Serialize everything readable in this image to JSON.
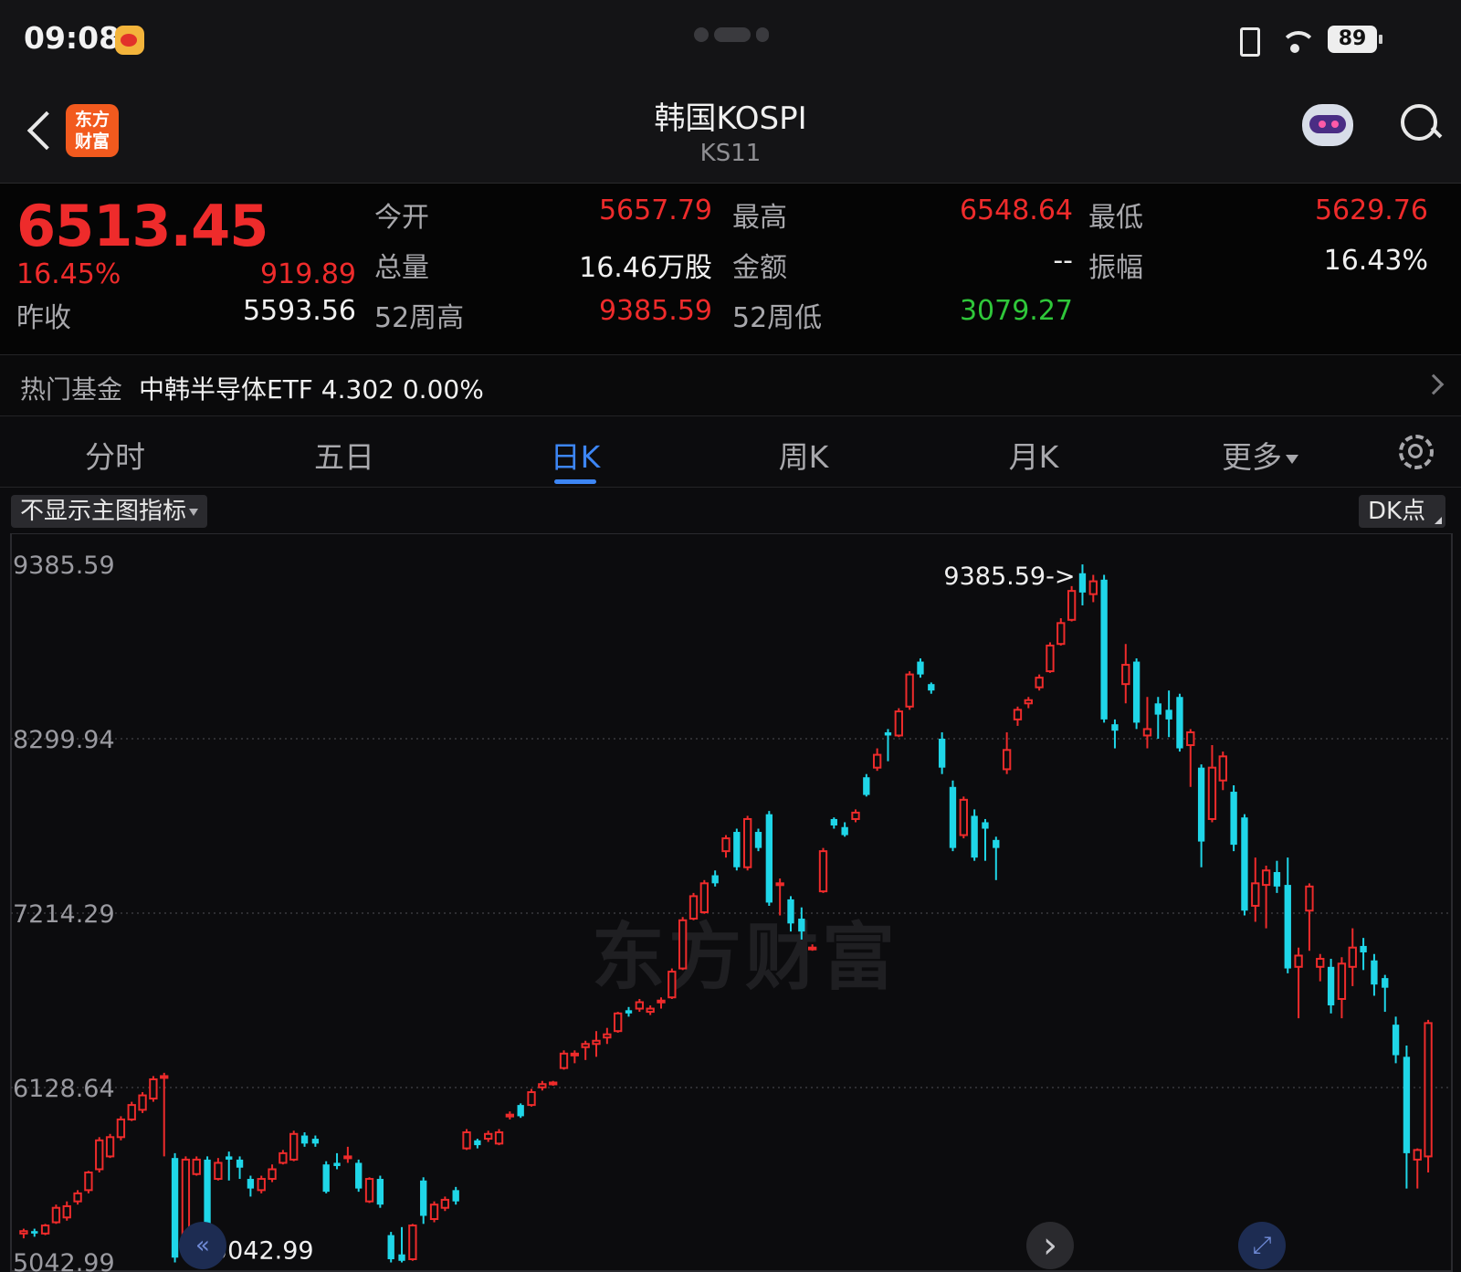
{
  "status_bar": {
    "time": "09:08",
    "battery": "89"
  },
  "header": {
    "title": "韩国KOSPI",
    "code": "KS11",
    "brand": "东方财富"
  },
  "quote": {
    "price": "6513.45",
    "change_pct": "16.45%",
    "change": "919.89",
    "rows": [
      [
        {
          "label": "今开",
          "value": "5657.79",
          "color": "red"
        },
        {
          "label": "最高",
          "value": "6548.64",
          "color": "red"
        },
        {
          "label": "最低",
          "value": "5629.76",
          "color": "red"
        }
      ],
      [
        {
          "label": "总量",
          "value": "16.46万股",
          "color": "white"
        },
        {
          "label": "金额",
          "value": "--",
          "color": "white"
        },
        {
          "label": "振幅",
          "value": "16.43%",
          "color": "white"
        }
      ],
      [
        {
          "label": "52周高",
          "value": "9385.59",
          "color": "red"
        },
        {
          "label": "52周低",
          "value": "3079.27",
          "color": "green"
        }
      ]
    ],
    "prev_close_label": "昨收",
    "prev_close": "5593.56"
  },
  "hot_fund": {
    "label": "热门基金",
    "text": "中韩半导体ETF  4.302  0.00%"
  },
  "tabs": [
    "分时",
    "五日",
    "日K",
    "周K",
    "月K",
    "更多"
  ],
  "active_tab": "日K",
  "chart_controls": {
    "indicator": "不显示主图指标",
    "dk": "DK点"
  },
  "watermark": "东方财富",
  "colors": {
    "up": "#ee2b2b",
    "down": "#1fd6e8",
    "accent": "#3d86f5"
  },
  "chart_data": {
    "type": "candlestick",
    "y_ticks": [
      9385.59,
      8299.94,
      7214.29,
      6128.64,
      5042.99
    ],
    "y_tick_labels": [
      "9385.59",
      "8299.94",
      "7214.29",
      "6128.64",
      "5042.99"
    ],
    "ylim": [
      5042.99,
      9385.59
    ],
    "max_label": "9385.59->",
    "min_label": "<-5042.99",
    "grid": true,
    "candles": [
      [
        5220,
        5235,
        5190,
        5250
      ],
      [
        5235,
        5220,
        5200,
        5250
      ],
      [
        5220,
        5270,
        5210,
        5280
      ],
      [
        5290,
        5380,
        5280,
        5400
      ],
      [
        5320,
        5390,
        5300,
        5420
      ],
      [
        5420,
        5470,
        5400,
        5490
      ],
      [
        5490,
        5600,
        5470,
        5610
      ],
      [
        5620,
        5800,
        5600,
        5820
      ],
      [
        5700,
        5820,
        5690,
        5840
      ],
      [
        5820,
        5930,
        5800,
        5950
      ],
      [
        5930,
        6020,
        5920,
        6040
      ],
      [
        5990,
        6080,
        5970,
        6100
      ],
      [
        6060,
        6180,
        6040,
        6200
      ],
      [
        6190,
        6200,
        5700,
        6220
      ],
      [
        5690,
        5070,
        5040,
        5720
      ],
      [
        5100,
        5680,
        5070,
        5700
      ],
      [
        5590,
        5680,
        5580,
        5700
      ],
      [
        5680,
        5080,
        5050,
        5700
      ],
      [
        5560,
        5660,
        5550,
        5690
      ],
      [
        5700,
        5680,
        5550,
        5730
      ],
      [
        5680,
        5630,
        5560,
        5700
      ],
      [
        5560,
        5500,
        5450,
        5580
      ],
      [
        5490,
        5560,
        5470,
        5580
      ],
      [
        5560,
        5620,
        5540,
        5650
      ],
      [
        5660,
        5720,
        5650,
        5740
      ],
      [
        5680,
        5840,
        5670,
        5860
      ],
      [
        5830,
        5780,
        5760,
        5850
      ],
      [
        5810,
        5780,
        5760,
        5830
      ],
      [
        5650,
        5480,
        5470,
        5670
      ],
      [
        5660,
        5640,
        5620,
        5720
      ],
      [
        5700,
        5700,
        5660,
        5760
      ],
      [
        5660,
        5500,
        5480,
        5680
      ],
      [
        5420,
        5560,
        5410,
        5570
      ],
      [
        5560,
        5400,
        5380,
        5580
      ],
      [
        5210,
        5060,
        5040,
        5230
      ],
      [
        5090,
        5050,
        5040,
        5260
      ],
      [
        5060,
        5270,
        5050,
        5280
      ],
      [
        5550,
        5330,
        5280,
        5570
      ],
      [
        5310,
        5400,
        5290,
        5420
      ],
      [
        5380,
        5430,
        5360,
        5450
      ],
      [
        5490,
        5420,
        5400,
        5510
      ],
      [
        5750,
        5850,
        5740,
        5870
      ],
      [
        5800,
        5770,
        5750,
        5810
      ],
      [
        5810,
        5840,
        5790,
        5860
      ],
      [
        5780,
        5850,
        5770,
        5870
      ],
      [
        5950,
        5960,
        5930,
        5980
      ],
      [
        6020,
        5950,
        5940,
        6030
      ],
      [
        6020,
        6100,
        6010,
        6120
      ],
      [
        6130,
        6150,
        6110,
        6170
      ],
      [
        6150,
        6160,
        6140,
        6170
      ],
      [
        6250,
        6340,
        6240,
        6360
      ],
      [
        6330,
        6340,
        6280,
        6360
      ],
      [
        6380,
        6400,
        6300,
        6420
      ],
      [
        6400,
        6420,
        6320,
        6480
      ],
      [
        6440,
        6460,
        6400,
        6500
      ],
      [
        6480,
        6590,
        6470,
        6600
      ],
      [
        6610,
        6590,
        6570,
        6630
      ],
      [
        6620,
        6660,
        6600,
        6680
      ],
      [
        6600,
        6620,
        6580,
        6640
      ],
      [
        6660,
        6670,
        6620,
        6690
      ],
      [
        6690,
        6850,
        6680,
        6870
      ],
      [
        6870,
        7170,
        6860,
        7190
      ],
      [
        7180,
        7320,
        7170,
        7340
      ],
      [
        7220,
        7400,
        7210,
        7420
      ],
      [
        7450,
        7400,
        7380,
        7480
      ],
      [
        7600,
        7680,
        7560,
        7700
      ],
      [
        7720,
        7500,
        7480,
        7740
      ],
      [
        7500,
        7800,
        7480,
        7820
      ],
      [
        7720,
        7620,
        7600,
        7740
      ],
      [
        7830,
        7280,
        7260,
        7850
      ],
      [
        7400,
        7400,
        7200,
        7430
      ],
      [
        7300,
        7150,
        7100,
        7320
      ],
      [
        7180,
        7100,
        7050,
        7250
      ],
      [
        7000,
        7000,
        6980,
        7020
      ],
      [
        7350,
        7600,
        7340,
        7620
      ],
      [
        7800,
        7760,
        7740,
        7810
      ],
      [
        7750,
        7700,
        7690,
        7780
      ],
      [
        7800,
        7840,
        7780,
        7860
      ],
      [
        8060,
        7950,
        7940,
        8080
      ],
      [
        8120,
        8200,
        8100,
        8240
      ],
      [
        8340,
        8320,
        8160,
        8360
      ],
      [
        8320,
        8470,
        8310,
        8490
      ],
      [
        8500,
        8700,
        8480,
        8720
      ],
      [
        8780,
        8700,
        8680,
        8800
      ],
      [
        8640,
        8600,
        8580,
        8650
      ],
      [
        8300,
        8120,
        8080,
        8340
      ],
      [
        8000,
        7620,
        7600,
        8040
      ],
      [
        7700,
        7920,
        7680,
        7940
      ],
      [
        7820,
        7560,
        7540,
        7860
      ],
      [
        7780,
        7740,
        7540,
        7800
      ],
      [
        7670,
        7620,
        7420,
        7690
      ],
      [
        8110,
        8230,
        8080,
        8340
      ],
      [
        8420,
        8480,
        8380,
        8500
      ],
      [
        8520,
        8540,
        8490,
        8560
      ],
      [
        8620,
        8680,
        8600,
        8700
      ],
      [
        8720,
        8880,
        8710,
        8900
      ],
      [
        8890,
        9020,
        8880,
        9050
      ],
      [
        9040,
        9220,
        9030,
        9250
      ],
      [
        9330,
        9210,
        9130,
        9385
      ],
      [
        9200,
        9280,
        9150,
        9320
      ],
      [
        9290,
        8420,
        8400,
        9320
      ],
      [
        8390,
        8350,
        8240,
        8420
      ],
      [
        8640,
        8760,
        8520,
        8890
      ],
      [
        8780,
        8400,
        8360,
        8800
      ],
      [
        8320,
        8360,
        8240,
        8560
      ],
      [
        8520,
        8450,
        8300,
        8560
      ],
      [
        8480,
        8420,
        8310,
        8600
      ],
      [
        8560,
        8240,
        8220,
        8580
      ],
      [
        8260,
        8340,
        8000,
        8360
      ],
      [
        8120,
        7660,
        7500,
        8140
      ],
      [
        7800,
        8120,
        7780,
        8260
      ],
      [
        8040,
        8190,
        7980,
        8220
      ],
      [
        7970,
        7640,
        7600,
        8010
      ],
      [
        7810,
        7230,
        7200,
        7830
      ],
      [
        7260,
        7400,
        7160,
        7560
      ],
      [
        7390,
        7480,
        7120,
        7510
      ],
      [
        7470,
        7380,
        7340,
        7540
      ],
      [
        7390,
        6870,
        6840,
        7560
      ],
      [
        6880,
        6950,
        6560,
        7000
      ],
      [
        7230,
        7380,
        6980,
        7400
      ],
      [
        6880,
        6930,
        6790,
        6960
      ],
      [
        6880,
        6640,
        6590,
        6930
      ],
      [
        6680,
        6900,
        6560,
        6940
      ],
      [
        6880,
        7000,
        6760,
        7120
      ],
      [
        7010,
        6970,
        6860,
        7060
      ],
      [
        6920,
        6770,
        6700,
        6960
      ],
      [
        6810,
        6750,
        6600,
        6830
      ],
      [
        6520,
        6330,
        6280,
        6570
      ],
      [
        6320,
        5720,
        5500,
        6390
      ],
      [
        5680,
        5740,
        5500,
        5750
      ],
      [
        5700,
        6530,
        5600,
        6550
      ]
    ]
  }
}
